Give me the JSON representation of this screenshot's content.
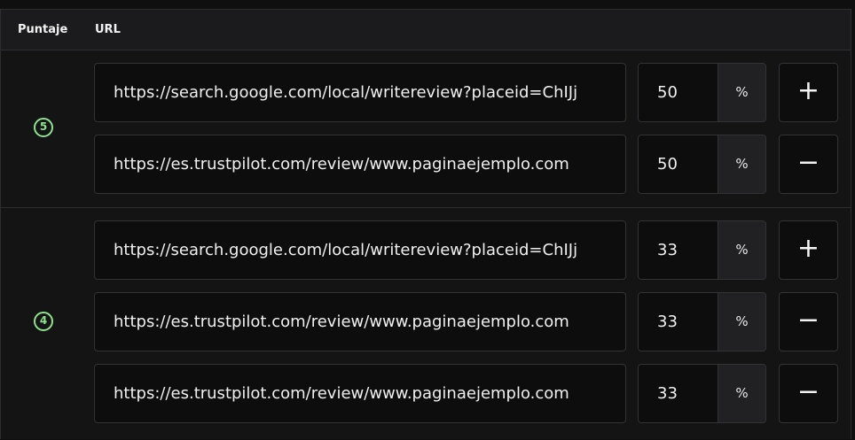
{
  "header": {
    "score_label": "Puntaje",
    "url_label": "URL"
  },
  "groups": [
    {
      "score": "5",
      "rows": [
        {
          "url": "https://search.google.com/local/writereview?placeid=ChIJj",
          "percent": "50",
          "unit": "%",
          "action": "+",
          "action_icon": "plus-icon"
        },
        {
          "url": "https://es.trustpilot.com/review/www.paginaejemplo.com",
          "percent": "50",
          "unit": "%",
          "action": "−",
          "action_icon": "minus-icon"
        }
      ]
    },
    {
      "score": "4",
      "rows": [
        {
          "url": "https://search.google.com/local/writereview?placeid=ChIJj",
          "percent": "33",
          "unit": "%",
          "action": "+",
          "action_icon": "plus-icon"
        },
        {
          "url": "https://es.trustpilot.com/review/www.paginaejemplo.com",
          "percent": "33",
          "unit": "%",
          "action": "−",
          "action_icon": "minus-icon"
        },
        {
          "url": "https://es.trustpilot.com/review/www.paginaejemplo.com",
          "percent": "33",
          "unit": "%",
          "action": "−",
          "action_icon": "minus-icon"
        }
      ]
    }
  ],
  "colors": {
    "score_badge": "#8ee28e",
    "background": "#141415",
    "border": "#2e2e30"
  }
}
